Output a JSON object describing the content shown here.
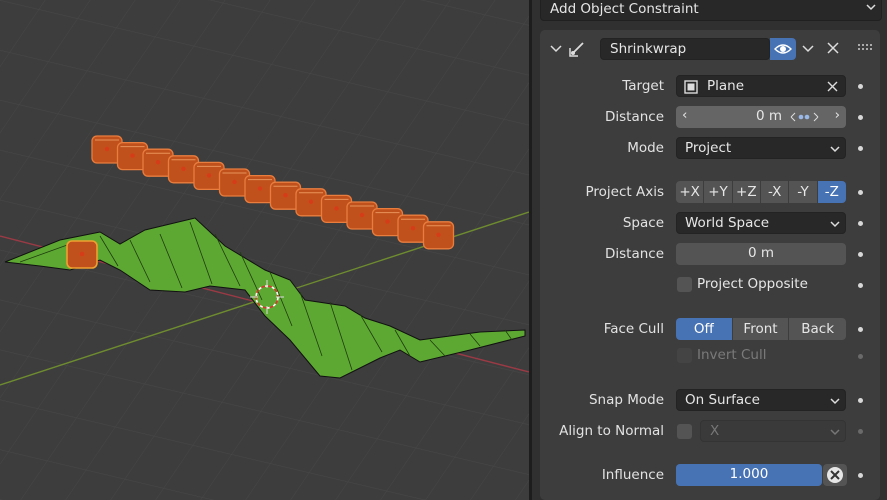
{
  "header": {
    "add_constraint_label": "Add Object Constraint"
  },
  "constraint": {
    "name": "Shrinkwrap",
    "target_label": "Target",
    "target_value": "Plane",
    "distance_label": "Distance",
    "distance_value": "0 m",
    "mode_label": "Mode",
    "mode_value": "Project",
    "project_axis_label": "Project Axis",
    "project_axes": [
      "+X",
      "+Y",
      "+Z",
      "-X",
      "-Y",
      "-Z"
    ],
    "project_axis_selected": "-Z",
    "space_label": "Space",
    "space_value": "World Space",
    "distance2_label": "Distance",
    "distance2_value": "0 m",
    "project_opposite_label": "Project Opposite",
    "face_cull_label": "Face Cull",
    "face_cull_options": [
      "Off",
      "Front",
      "Back"
    ],
    "face_cull_selected": "Off",
    "invert_cull_label": "Invert Cull",
    "snap_mode_label": "Snap Mode",
    "snap_mode_value": "On Surface",
    "align_normal_label": "Align to Normal",
    "align_normal_axis": "X",
    "influence_label": "Influence",
    "influence_value": "1.000",
    "influence_fraction": 1.0
  },
  "colors": {
    "accent": "#4772b3",
    "selected_object": "#e87d3e",
    "plane": "#5da832",
    "panel_bg": "#3d3d3d"
  },
  "icons": [
    "eye-icon",
    "chevron-down-icon",
    "close-icon",
    "drag-handle-icon",
    "constraint-icon",
    "object-icon",
    "animate-dots-icon"
  ]
}
